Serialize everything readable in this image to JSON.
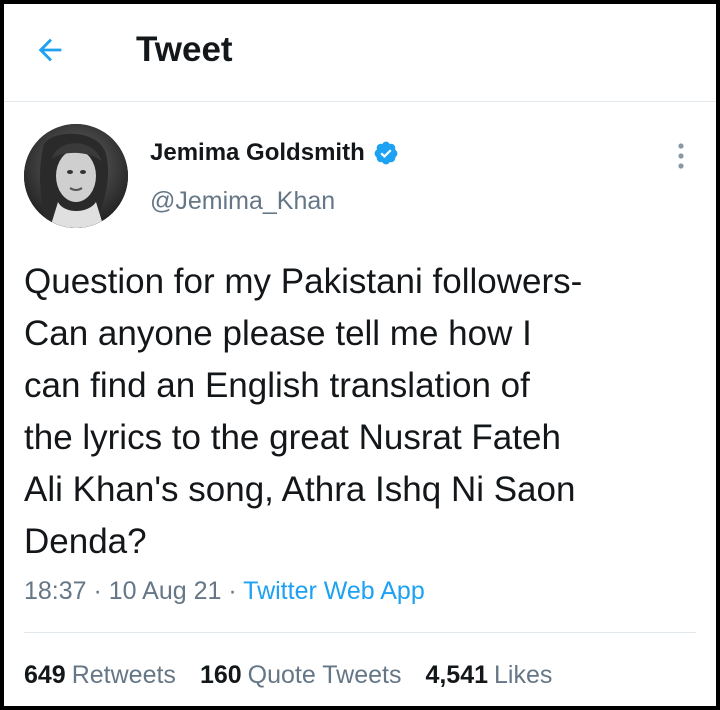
{
  "header": {
    "title": "Tweet",
    "back_icon": "arrow-left-icon"
  },
  "author": {
    "name": "Jemima Goldsmith",
    "handle": "@Jemima_Khan",
    "verified": true
  },
  "tweet": {
    "lines": [
      "Question for my Pakistani followers-",
      "Can anyone please tell me how I",
      "can find an English translation of",
      "the lyrics to the great Nusrat Fateh",
      "Ali Khan's song, Athra Ishq Ni Saon",
      "Denda?"
    ],
    "time": "18:37",
    "sep1": " · ",
    "date": "10 Aug 21",
    "sep2": " · ",
    "source": "Twitter Web App"
  },
  "stats": {
    "retweets_count": "649",
    "retweets_label": "Retweets",
    "quotes_count": "160",
    "quotes_label": "Quote Tweets",
    "likes_count": "4,541",
    "likes_label": "Likes"
  },
  "colors": {
    "accent": "#1da1f2",
    "text": "#14171a",
    "secondary": "#657786",
    "divider": "#e1e8ed"
  }
}
